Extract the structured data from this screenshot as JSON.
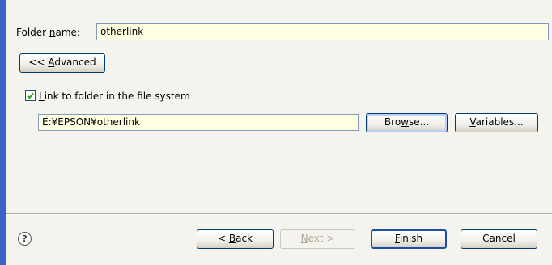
{
  "folder_name": {
    "label_pre": "Folder ",
    "label_mnemonic": "n",
    "label_post": "ame:",
    "value": "otherlink"
  },
  "advanced_button": {
    "label_pre": "<< ",
    "label_mnemonic": "A",
    "label_post": "dvanced"
  },
  "link": {
    "checked": true,
    "label_mnemonic": "L",
    "label_post": "ink to folder in the file system",
    "path": "E:¥EPSON¥otherlink",
    "browse_pre": "Bro",
    "browse_mnemonic": "w",
    "browse_post": "se...",
    "variables_mnemonic": "V",
    "variables_post": "ariables..."
  },
  "footer": {
    "help_glyph": "?",
    "back_pre": "< ",
    "back_mnemonic": "B",
    "back_post": "ack",
    "next_mnemonic": "N",
    "next_post": "ext >",
    "finish_mnemonic": "F",
    "finish_post": "inish",
    "cancel": "Cancel"
  },
  "colors": {
    "accent": "#3d62c4",
    "input_bg": "#ffffe1",
    "panel_bg": "#f4f3ee"
  }
}
